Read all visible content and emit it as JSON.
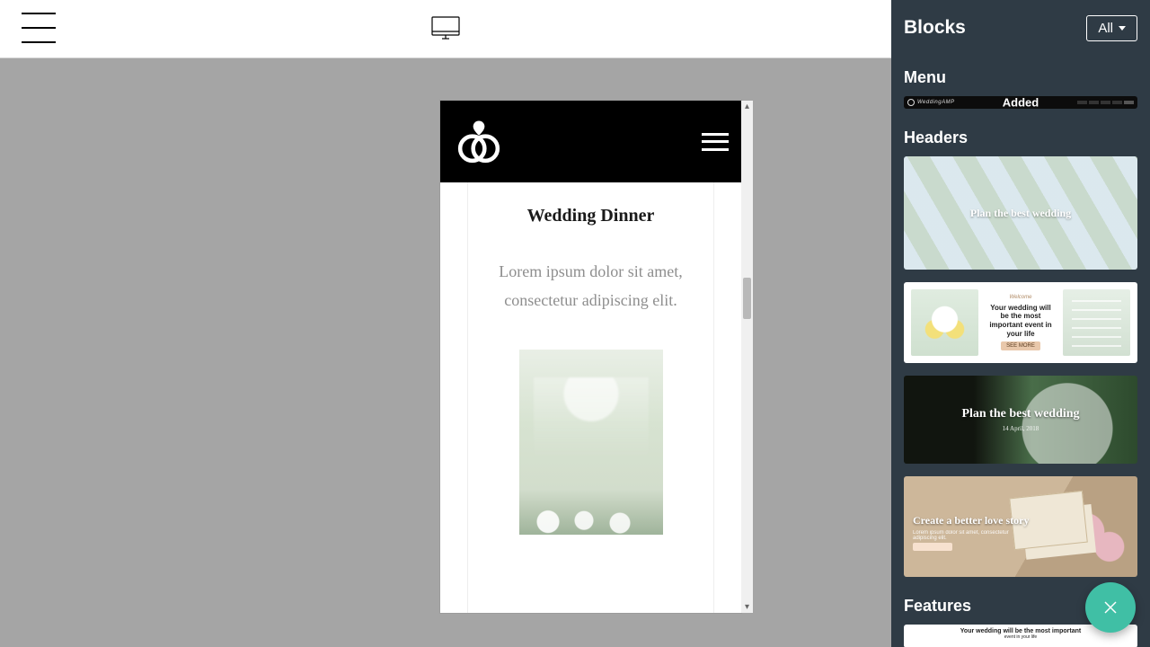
{
  "topbar": {
    "menu_icon": "hamburger-icon",
    "device_icon": "desktop-icon"
  },
  "preview": {
    "logo_icon": "wedding-rings-icon",
    "menu_icon": "hamburger-icon",
    "card": {
      "title": "Wedding Dinner",
      "description": "Lorem ipsum dolor sit amet, consectetur adipiscing elit."
    }
  },
  "sidebar": {
    "title": "Blocks",
    "filter_button": "All",
    "sections": {
      "menu": {
        "title": "Menu",
        "items": [
          {
            "brand": "WeddingAMP",
            "status": "Added"
          }
        ]
      },
      "headers": {
        "title": "Headers",
        "items": [
          {
            "caption": "Plan the best wedding"
          },
          {
            "eyebrow": "Welcome",
            "caption": "Your wedding will be the most important event in your life",
            "button": "SEE MORE"
          },
          {
            "caption": "Plan the best wedding",
            "subcaption": "14 April, 2018"
          },
          {
            "caption": "Create a better love story",
            "subcaption": "Lorem ipsum dolor sit amet, consectetur adipiscing elit."
          }
        ]
      },
      "features": {
        "title": "Features",
        "items": [
          {
            "caption": "Your wedding will be the most important",
            "subcaption": "event in your life"
          }
        ]
      }
    }
  },
  "fab": {
    "icon": "close-icon"
  }
}
